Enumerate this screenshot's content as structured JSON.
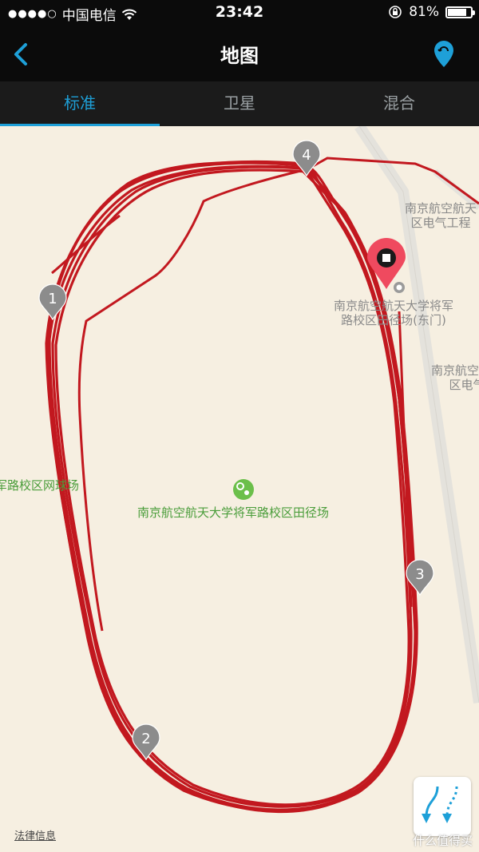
{
  "status_bar": {
    "carrier": "中国电信",
    "time": "23:42",
    "battery_percent": "81%",
    "battery_level": 0.81
  },
  "nav": {
    "title": "地图",
    "back_icon": "chevron-left-icon",
    "right_icon": "location-pin-icon"
  },
  "tabs": [
    {
      "label": "标准",
      "active": true
    },
    {
      "label": "卫星",
      "active": false
    },
    {
      "label": "混合",
      "active": false
    }
  ],
  "map": {
    "track_color": "#c2181f",
    "poi_labels": {
      "electric_top": "南京航空航天\n区电气工程",
      "east_gate": "南京航空航天大学将军\n路校区田径场(东门)",
      "electric_mid": "南京航空航天\n区电气",
      "tennis": "军路校区网球场",
      "stadium": "南京航空航天大学将军路校区田径场"
    },
    "lap_markers": [
      "1",
      "2",
      "3",
      "4"
    ],
    "legal_link": "法律信息",
    "watermark": "什么值得买"
  }
}
